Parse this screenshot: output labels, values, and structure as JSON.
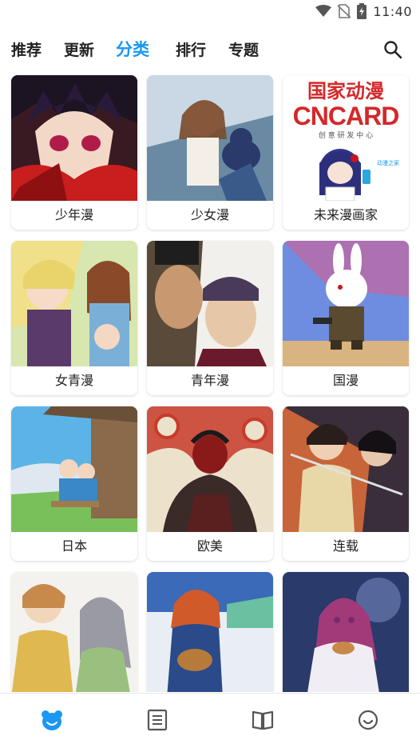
{
  "status_bar": {
    "time": "11:40",
    "icons": [
      "wifi-icon",
      "no-sim-icon",
      "battery-charging-icon"
    ]
  },
  "nav": {
    "tabs": [
      {
        "label": "推荐",
        "active": false
      },
      {
        "label": "更新",
        "active": false
      },
      {
        "label": "分类",
        "active": true
      },
      {
        "label": "排行",
        "active": false
      },
      {
        "label": "专题",
        "active": false
      }
    ],
    "search_icon": "search-icon",
    "accent_color": "#1a97f5"
  },
  "categories": [
    {
      "label": "少年漫"
    },
    {
      "label": "少女漫"
    },
    {
      "label": "未来漫画家",
      "cover_text": {
        "title": "国家动漫",
        "logo": "CNCARD",
        "subtitle": "创 意 研 发 中 心",
        "badge": "动漫之家"
      }
    },
    {
      "label": "女青漫"
    },
    {
      "label": "青年漫"
    },
    {
      "label": "国漫"
    },
    {
      "label": "日本"
    },
    {
      "label": "欧美"
    },
    {
      "label": "连载"
    },
    {
      "label": ""
    },
    {
      "label": ""
    },
    {
      "label": ""
    }
  ],
  "bottom_nav": [
    {
      "icon": "bear-icon",
      "active": true
    },
    {
      "icon": "list-icon",
      "active": false
    },
    {
      "icon": "book-icon",
      "active": false
    },
    {
      "icon": "smiley-icon",
      "active": false
    }
  ]
}
